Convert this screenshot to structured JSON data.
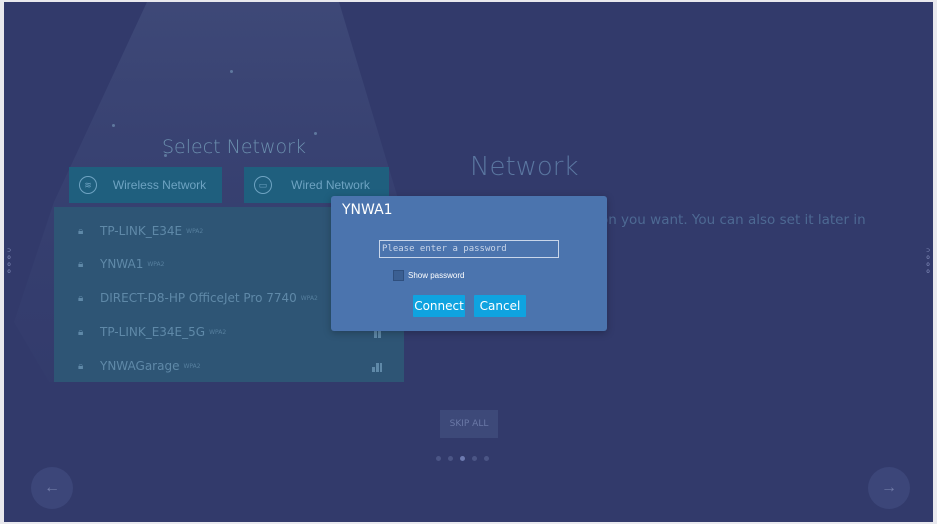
{
  "left_panel": {
    "title": "Select Network",
    "wireless_label": "Wireless Network",
    "wired_label": "Wired Network",
    "networks": [
      {
        "name": "TP-LINK_E34E",
        "security": "WPA2",
        "signal": 4
      },
      {
        "name": "YNWA1",
        "security": "WPA2",
        "signal": 4
      },
      {
        "name": "DIRECT-D8-HP OfficeJet Pro 7740",
        "security": "WPA2",
        "signal": 3
      },
      {
        "name": "TP-LINK_E34E_5G",
        "security": "WPA2",
        "signal": 2
      },
      {
        "name": "YNWAGarage",
        "security": "WPA2",
        "signal": 3
      }
    ]
  },
  "right_panel": {
    "title": "Network",
    "description": "Select the connection you want. You can also set it later in the system settings."
  },
  "dialog": {
    "title": "YNWA1",
    "password_placeholder": "Please enter a password",
    "password_value": "",
    "show_password_label": "Show password",
    "show_password_checked": false,
    "connect_label": "Connect",
    "cancel_label": "Cancel"
  },
  "footer": {
    "skip_label": "SKIP ALL",
    "page_count": 5,
    "active_page": 3
  },
  "icons": {
    "wireless": "wifi-icon",
    "wired": "ethernet-icon",
    "lock": "lock-icon",
    "signal": "signal-strength-icon",
    "prev": "arrow-left-icon",
    "next": "arrow-right-icon"
  },
  "colors": {
    "background": "#323a6b",
    "accent": "#0fa3e0",
    "dialog": "#4b74ae",
    "list_panel": "#2e5575"
  }
}
